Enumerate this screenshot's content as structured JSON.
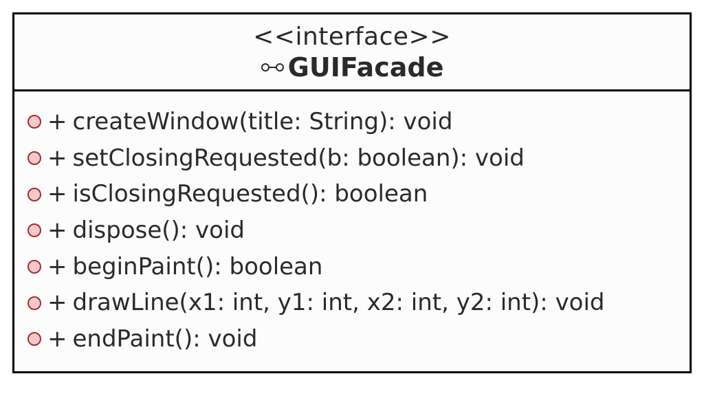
{
  "uml": {
    "stereotype": "<<interface>>",
    "className": "GUIFacade",
    "members": [
      {
        "visibility": "+",
        "signature": "createWindow(title: String): void"
      },
      {
        "visibility": "+",
        "signature": "setClosingRequested(b: boolean): void"
      },
      {
        "visibility": "+",
        "signature": "isClosingRequested(): boolean"
      },
      {
        "visibility": "+",
        "signature": "dispose(): void"
      },
      {
        "visibility": "+",
        "signature": "beginPaint(): boolean"
      },
      {
        "visibility": "+",
        "signature": "drawLine(x1: int, y1: int, x2: int, y2: int): void"
      },
      {
        "visibility": "+",
        "signature": "endPaint(): void"
      }
    ]
  },
  "colors": {
    "bulletFill": "#f7c8c8",
    "bulletStroke": "#a03030",
    "border": "#000000",
    "text": "#2a2a2a"
  }
}
